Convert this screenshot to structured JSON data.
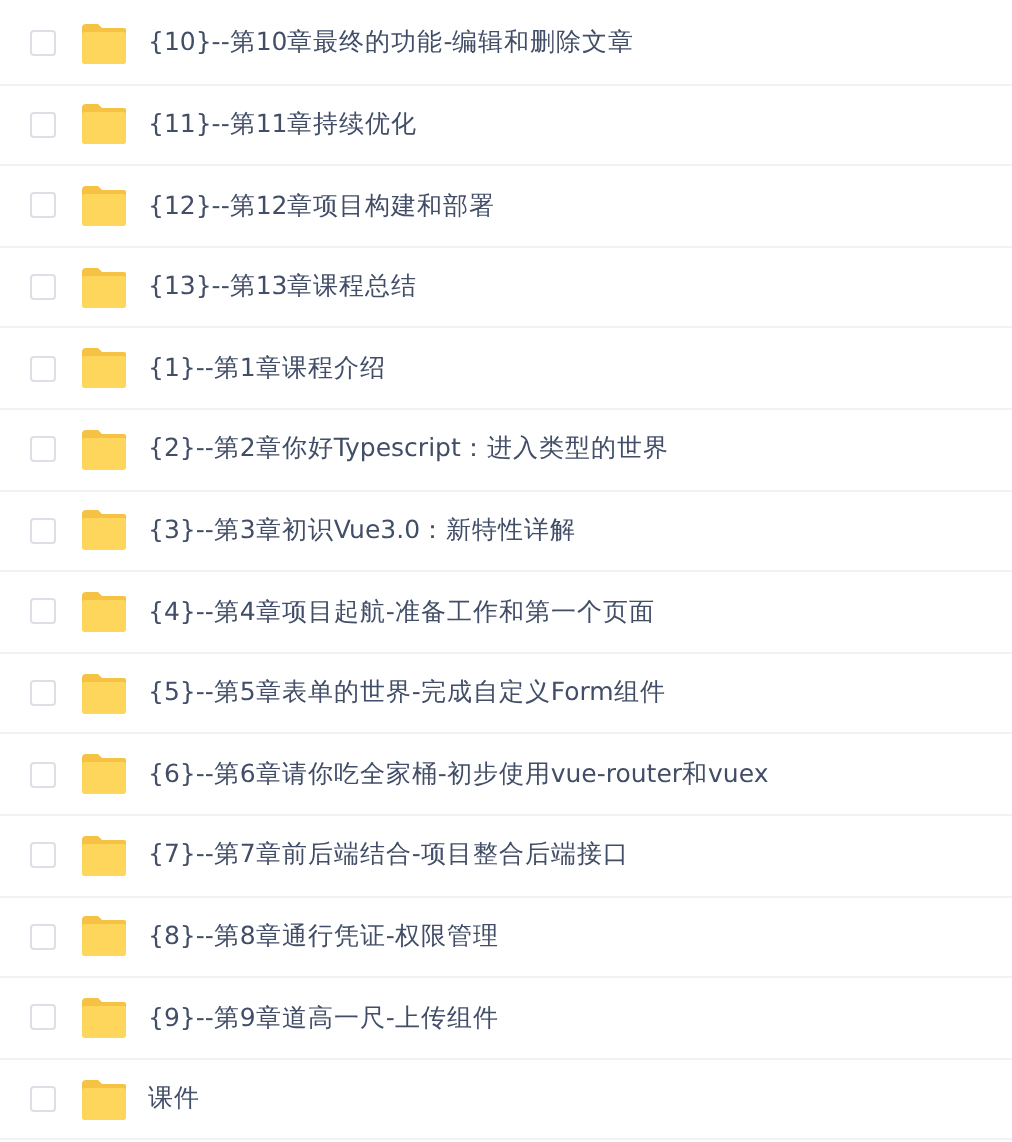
{
  "files": [
    {
      "name": "{10}--第10章最终的功能-编辑和删除文章",
      "checked": false
    },
    {
      "name": "{11}--第11章持续优化",
      "checked": false
    },
    {
      "name": "{12}--第12章项目构建和部署",
      "checked": false
    },
    {
      "name": "{13}--第13章课程总结",
      "checked": false
    },
    {
      "name": "{1}--第1章课程介绍",
      "checked": false
    },
    {
      "name": "{2}--第2章你好Typescript：进入类型的世界",
      "checked": false
    },
    {
      "name": "{3}--第3章初识Vue3.0：新特性详解",
      "checked": false
    },
    {
      "name": "{4}--第4章项目起航-准备工作和第一个页面",
      "checked": false
    },
    {
      "name": "{5}--第5章表单的世界-完成自定义Form组件",
      "checked": false
    },
    {
      "name": "{6}--第6章请你吃全家桶-初步使用vue-router和vuex",
      "checked": false
    },
    {
      "name": "{7}--第7章前后端结合-项目整合后端接口",
      "checked": false
    },
    {
      "name": "{8}--第8章通行凭证-权限管理",
      "checked": false
    },
    {
      "name": "{9}--第9章道高一尺-上传组件",
      "checked": false
    },
    {
      "name": "课件",
      "checked": false
    }
  ]
}
